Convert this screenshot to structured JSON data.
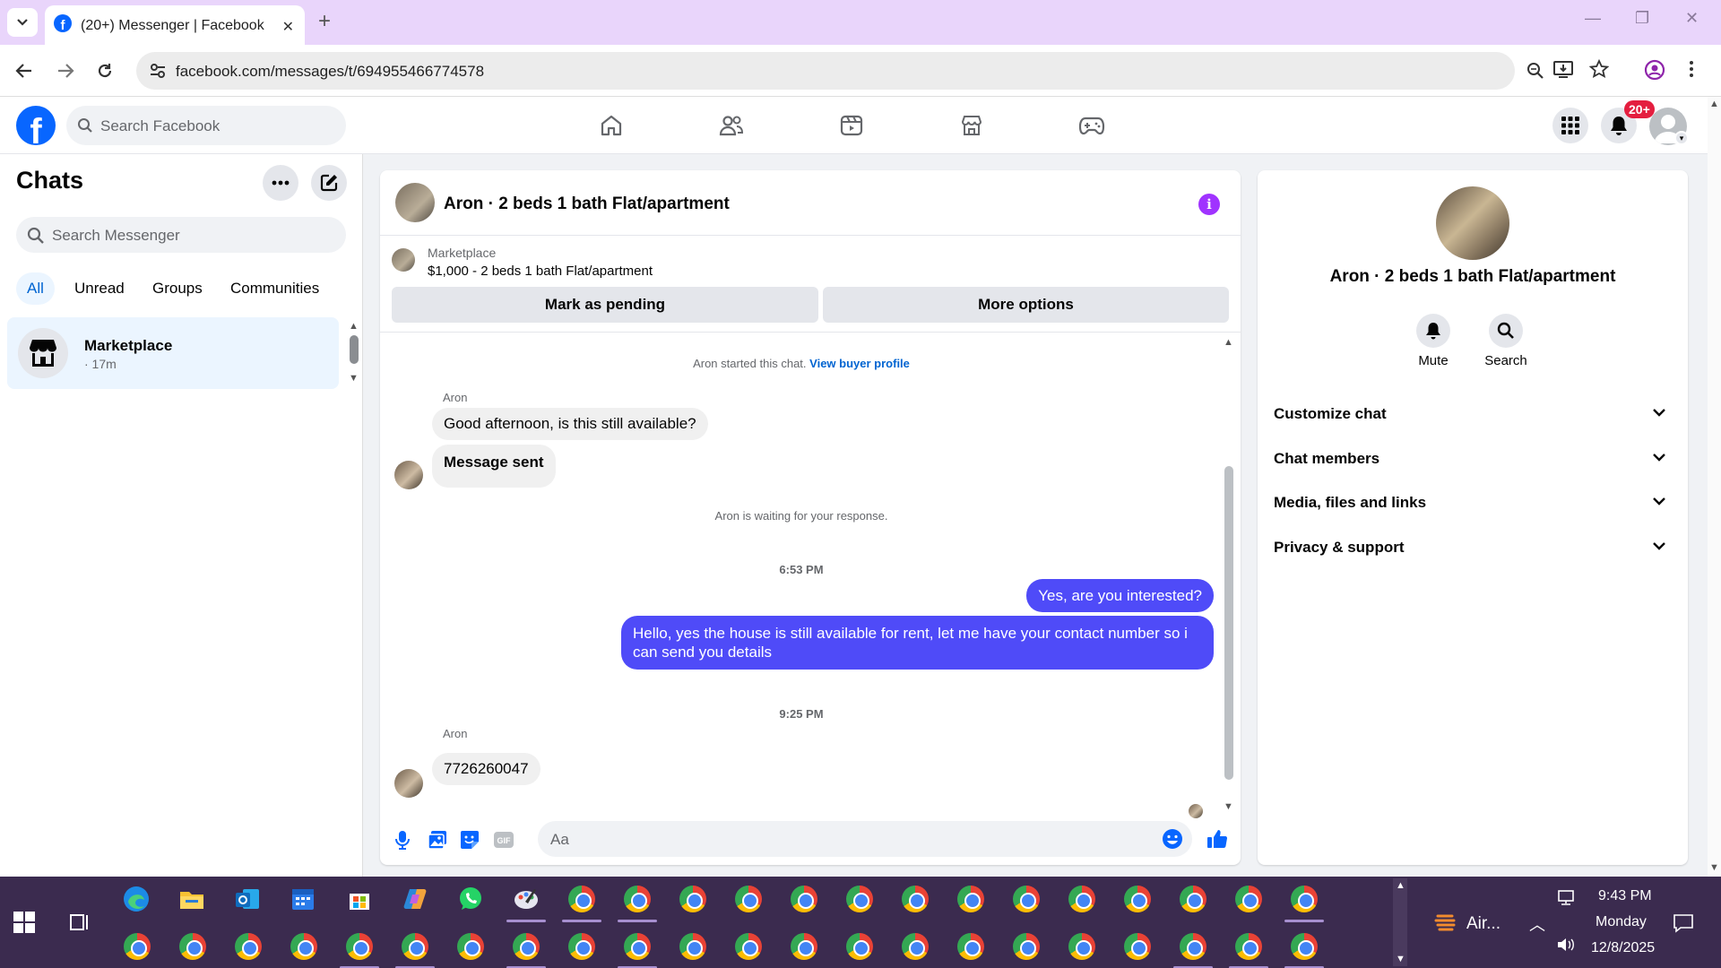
{
  "browser": {
    "tab_title": "(20+) Messenger | Facebook",
    "url": "facebook.com/messages/t/694955466774578"
  },
  "fb": {
    "search_placeholder": "Search Facebook",
    "notification_badge": "20+",
    "brand_color": "#0866ff"
  },
  "sidebar": {
    "title": "Chats",
    "search_placeholder": "Search Messenger",
    "filters": [
      "All",
      "Unread",
      "Groups",
      "Communities"
    ],
    "active_filter": "All",
    "chats": [
      {
        "name": "Marketplace",
        "time": "· 17m"
      }
    ]
  },
  "conversation": {
    "title": "Aron · 2 beds 1 bath Flat/apartment",
    "marketplace_label": "Marketplace",
    "listing": "$1,000 - 2 beds 1 bath Flat/apartment",
    "actions": [
      "Mark as pending",
      "More options"
    ],
    "started_text": "Aron started this chat. ",
    "buyer_profile_link": "View buyer profile",
    "messages": [
      {
        "sender": "Aron",
        "text": "Good afternoon, is this still available?"
      },
      {
        "text": "Message sent"
      },
      {
        "system": "Aron is waiting for your response."
      },
      {
        "time": "6:53 PM"
      },
      {
        "text": "Yes, are you interested?"
      },
      {
        "text": "Hello, yes the house is still available for rent, let me have your contact number so i can send you details"
      },
      {
        "time": "9:25 PM"
      },
      {
        "sender": "Aron",
        "text": "7726260047"
      }
    ],
    "composer_placeholder": "Aa",
    "outgoing_color": "#4f4bf8"
  },
  "right_panel": {
    "name": "Aron · 2 beds 1 bath Flat/apartment",
    "actions": [
      "Mute",
      "Search"
    ],
    "sections": [
      "Customize chat",
      "Chat members",
      "Media, files and links",
      "Privacy & support"
    ]
  },
  "taskbar": {
    "tray_app": "Air...",
    "time": "9:43 PM",
    "day": "Monday",
    "date": "12/8/2025"
  }
}
